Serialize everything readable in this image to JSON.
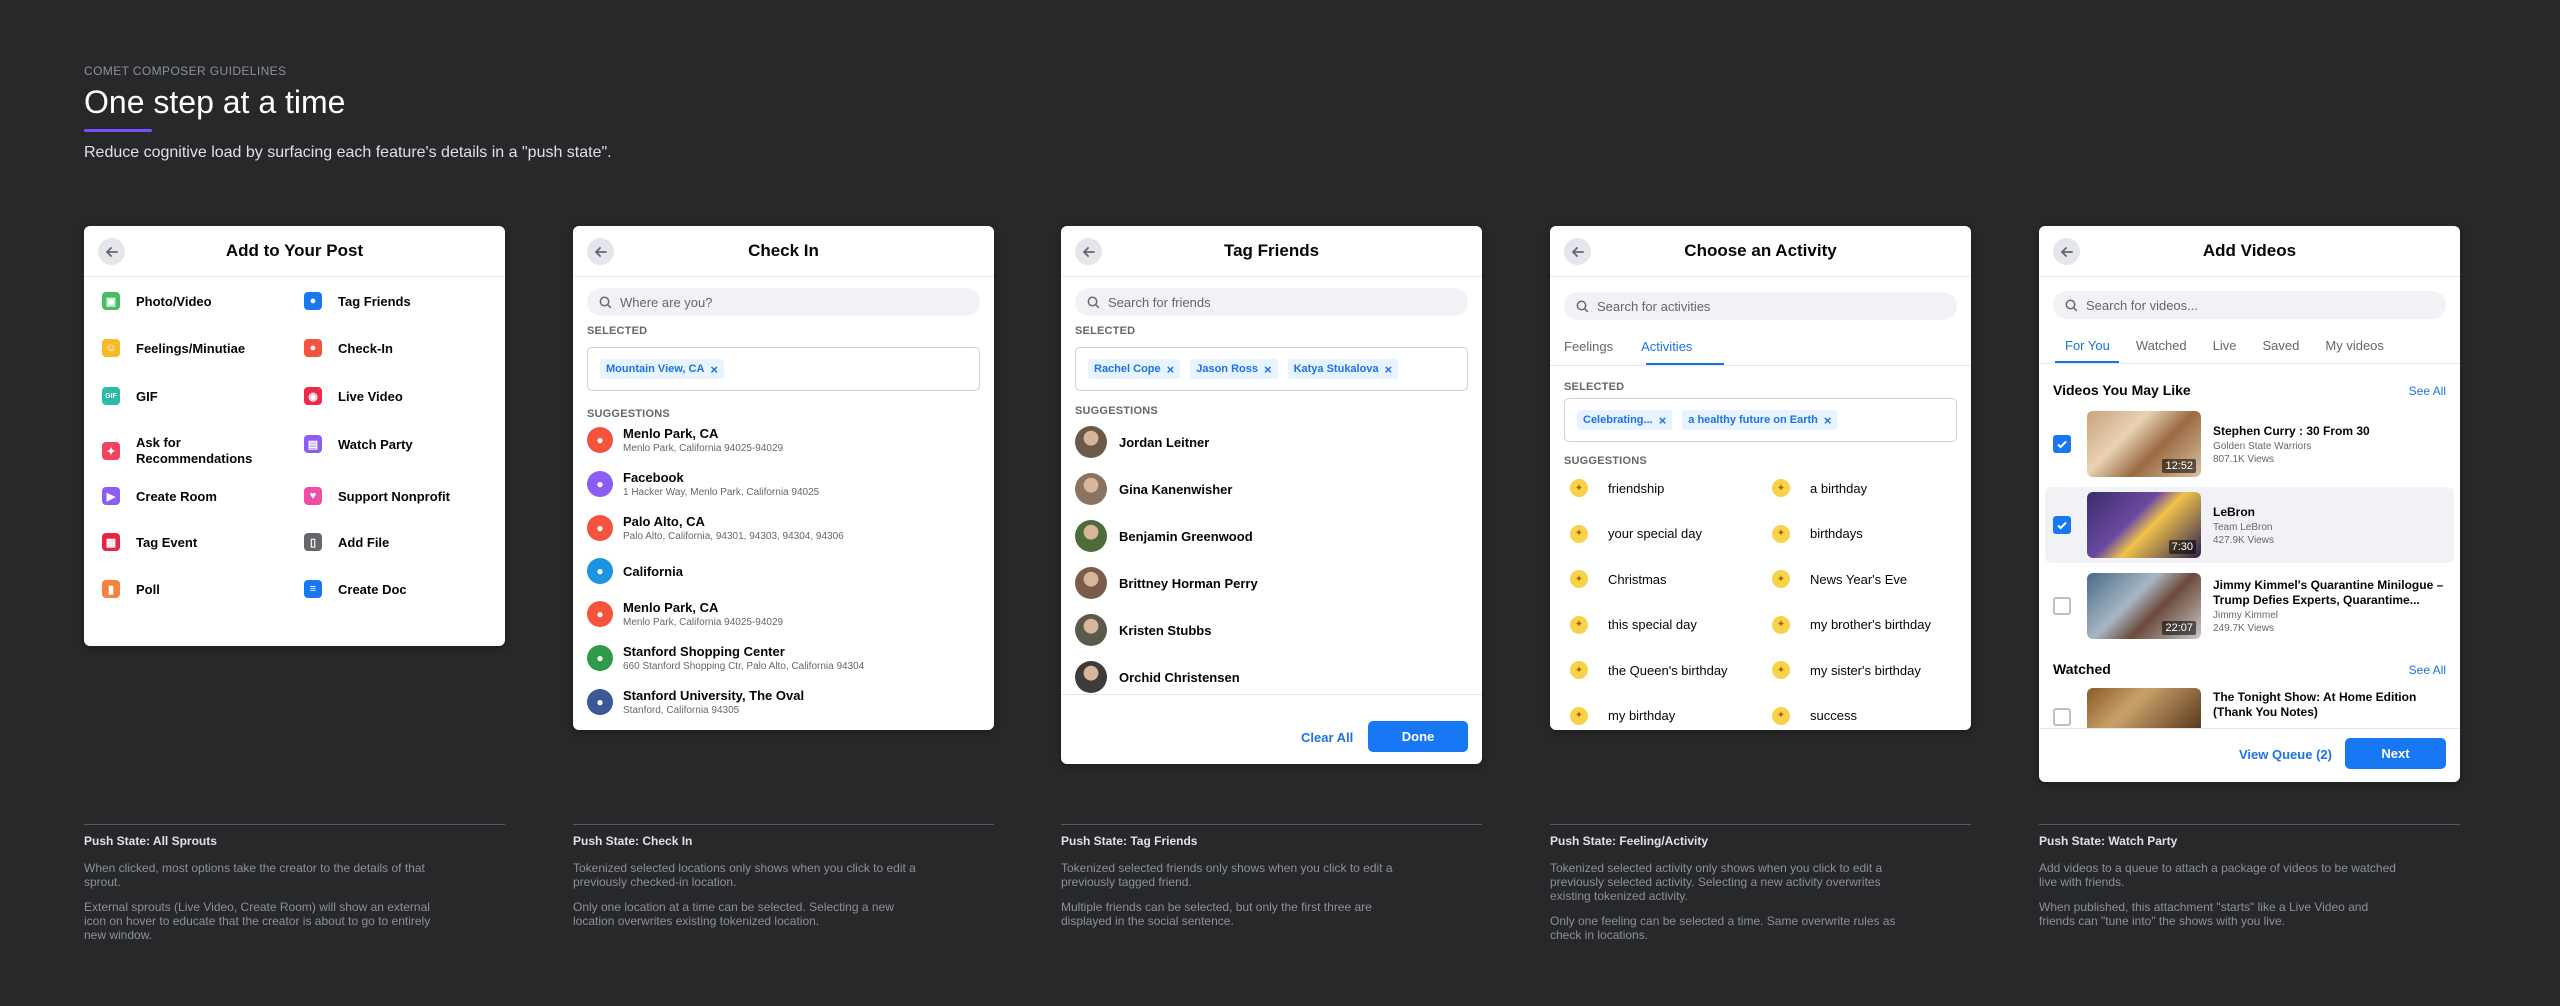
{
  "header": {
    "eyebrow": "COMET COMPOSER GUIDELINES",
    "title": "One step at a time",
    "subtitle": "Reduce cognitive load by surfacing each feature's details in a \"push state\"."
  },
  "colors": {
    "background": "#27282a",
    "accent": "#1877f2",
    "title_underline": "#7b4dff"
  },
  "card1": {
    "title": "Add to Your Post",
    "left": [
      {
        "label": "Photo/Video",
        "icon": "photo-icon",
        "color": "#45bd62"
      },
      {
        "label": "Feelings/Minutiae",
        "icon": "smile-icon",
        "color": "#f7b928"
      },
      {
        "label": "GIF",
        "icon": "gif-icon",
        "color": "#2abba7"
      },
      {
        "label": "Ask for Recommendations",
        "icon": "recommendation-icon",
        "color": "#f3425f"
      },
      {
        "label": "Create Room",
        "icon": "room-icon",
        "color": "#8c5cf5"
      },
      {
        "label": "Tag Event",
        "icon": "calendar-icon",
        "color": "#e42645"
      },
      {
        "label": "Poll",
        "icon": "poll-icon",
        "color": "#f5833f"
      }
    ],
    "right": [
      {
        "label": "Tag Friends",
        "icon": "tag-friends-icon",
        "color": "#1877f2"
      },
      {
        "label": "Check-In",
        "icon": "location-pin-icon",
        "color": "#f5533d"
      },
      {
        "label": "Live Video",
        "icon": "live-video-icon",
        "color": "#f02849"
      },
      {
        "label": "Watch Party",
        "icon": "watch-party-icon",
        "color": "#8c5cf5"
      },
      {
        "label": "Support Nonprofit",
        "icon": "heart-icon",
        "color": "#ec4fa5"
      },
      {
        "label": "Add File",
        "icon": "file-icon",
        "color": "#65676b"
      },
      {
        "label": "Create Doc",
        "icon": "doc-icon",
        "color": "#1877f2"
      }
    ]
  },
  "card2": {
    "title": "Check In",
    "search_placeholder": "Where are you?",
    "selected_label": "SELECTED",
    "selected": [
      "Mountain View, CA"
    ],
    "suggestions_label": "SUGGESTIONS",
    "suggestions": [
      {
        "name": "Menlo Park, CA",
        "address": "Menlo Park, California 94025-94029",
        "color": "#f5533d"
      },
      {
        "name": "Facebook",
        "address": "1 Hacker Way, Menlo Park, California 94025",
        "color": "#8c5cf5"
      },
      {
        "name": "Palo Alto, CA",
        "address": "Palo Alto, California, 94301, 94303, 94304, 94306",
        "color": "#f5533d"
      },
      {
        "name": "California",
        "address": "",
        "color": "#1b95e0"
      },
      {
        "name": "Menlo Park, CA",
        "address": "Menlo Park, California 94025-94029",
        "color": "#f5533d"
      },
      {
        "name": "Stanford Shopping Center",
        "address": "660 Stanford Shopping Ctr, Palo Alto, California 94304",
        "color": "#2e9b4b"
      },
      {
        "name": "Stanford University, The Oval",
        "address": "Stanford, California 94305",
        "color": "#3b5998"
      }
    ]
  },
  "card3": {
    "title": "Tag Friends",
    "search_placeholder": "Search for friends",
    "selected_label": "SELECTED",
    "selected": [
      "Rachel Cope",
      "Jason Ross",
      "Katya Stukalova"
    ],
    "suggestions_label": "SUGGESTIONS",
    "friends": [
      "Jordan Leitner",
      "Gina Kanenwisher",
      "Benjamin Greenwood",
      "Brittney Horman Perry",
      "Kristen Stubbs",
      "Orchid Christensen"
    ],
    "clear_label": "Clear All",
    "done_label": "Done"
  },
  "card4": {
    "title": "Choose an Activity",
    "search_placeholder": "Search for activities",
    "tabs": [
      "Feelings",
      "Activities"
    ],
    "selected_label": "SELECTED",
    "selected": [
      "Celebrating...",
      "a healthy future on Earth"
    ],
    "suggestions_label": "SUGGESTIONS",
    "left": [
      "friendship",
      "your special day",
      "Christmas",
      "this special day",
      "the Queen's birthday",
      "my birthday"
    ],
    "right": [
      "a birthday",
      "birthdays",
      "News Year's Eve",
      "my brother's birthday",
      "my sister's birthday",
      "success"
    ]
  },
  "card5": {
    "title": "Add Videos",
    "search_placeholder": "Search for videos...",
    "tabs": [
      "For You",
      "Watched",
      "Live",
      "Saved",
      "My videos"
    ],
    "section1": "Videos You May Like",
    "see_all": "See All",
    "videos": [
      {
        "title": "Stephen Curry : 30 From 30",
        "source": "Golden State Warriors",
        "views": "807.1K Views",
        "duration": "12:52",
        "checked": true
      },
      {
        "title": "LeBron",
        "source": "Team LeBron",
        "views": "427.9K Views",
        "duration": "7:30",
        "checked": true
      },
      {
        "title": "Jimmy Kimmel's Quarantine Minilogue – Trump Defies Experts, Quarantime...",
        "source": "Jimmy Kimmel",
        "views": "249.7K Views",
        "duration": "22:07",
        "checked": false
      }
    ],
    "section2": "Watched",
    "see_all2": "See All",
    "watched": [
      {
        "title": "The Tonight Show: At Home Edition (Thank You Notes)"
      }
    ],
    "queue_label": "View Queue (2)",
    "next_label": "Next"
  },
  "notes": [
    {
      "title": "Push State: All Sprouts",
      "p1": "When clicked, most options take the creator to the details of that sprout.",
      "p2": "External sprouts (Live Video, Create Room) will show an external icon on hover to educate that the creator is about to go to entirely new window."
    },
    {
      "title": "Push State: Check In",
      "p1": "Tokenized selected locations only shows when you click to edit a previously checked-in location.",
      "p2": "Only one location at a time can be selected. Selecting a new location overwrites existing tokenized location."
    },
    {
      "title": "Push State: Tag Friends",
      "p1": "Tokenized selected friends only shows when you click to edit a previously tagged friend.",
      "p2": "Multiple friends can be selected, but only the first three are displayed in the social sentence."
    },
    {
      "title": "Push State: Feeling/Activity",
      "p1": "Tokenized selected activity only shows when you click to edit a previously selected activity. Selecting a new activity overwrites existing tokenized activity.",
      "p2": "Only one feeling can be selected a time. Same overwrite rules as check in locations."
    },
    {
      "title": "Push State: Watch Party",
      "p1": "Add videos to a queue to attach a package of videos to be watched live with friends.",
      "p2": "When published, this attachment \"starts\" like a Live Video and friends can \"tune into\" the shows with you live."
    }
  ]
}
